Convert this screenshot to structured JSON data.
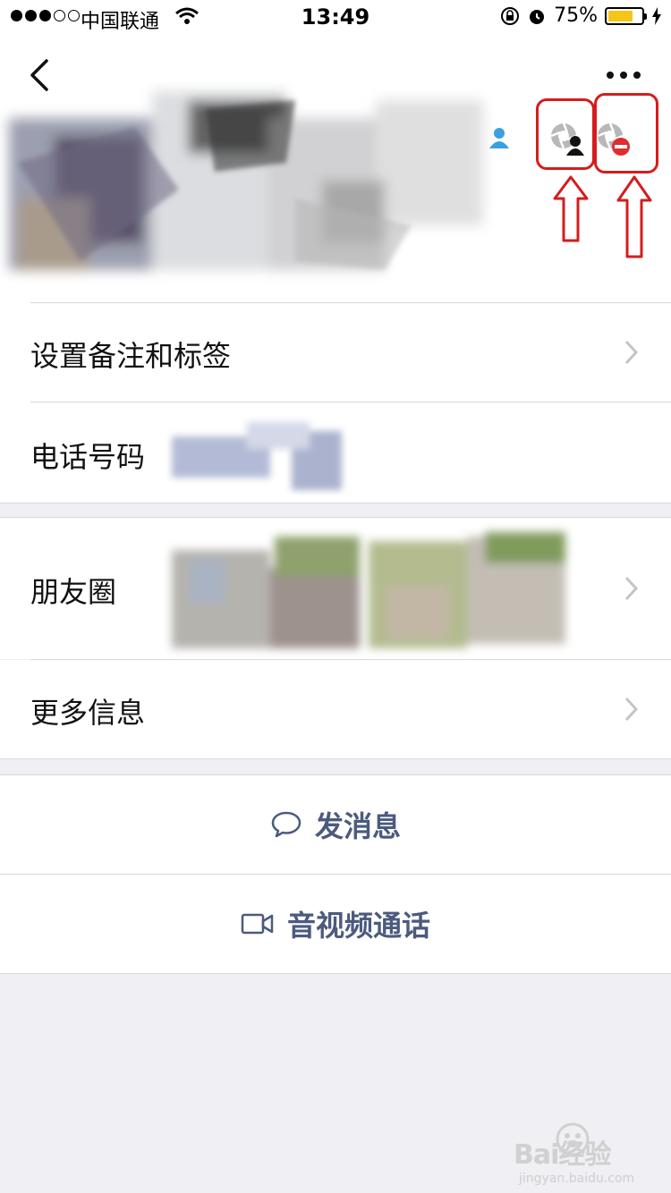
{
  "status_bar": {
    "carrier": "中国联通",
    "time": "13:49",
    "battery_percent": "75%",
    "battery_level": 0.75
  },
  "nav": {
    "back_icon": "chevron-left-icon",
    "more_icon": "ellipsis-icon"
  },
  "header": {
    "permission_icons": [
      "hide-moments-icon",
      "block-moments-icon"
    ],
    "highlight_color": "#d61c1c"
  },
  "rows": {
    "remark": {
      "label": "设置备注和标签"
    },
    "phone": {
      "label": "电话号码"
    },
    "moments": {
      "label": "朋友圈"
    },
    "more_info": {
      "label": "更多信息"
    }
  },
  "actions": {
    "message": {
      "label": "发消息",
      "icon": "chat-bubble-icon"
    },
    "call": {
      "label": "音视频通话",
      "icon": "video-camera-icon"
    }
  },
  "accent_color": "#4c5a7e",
  "watermark": {
    "brand": "Bai经验",
    "sub": "jingyan.baidu.com"
  }
}
